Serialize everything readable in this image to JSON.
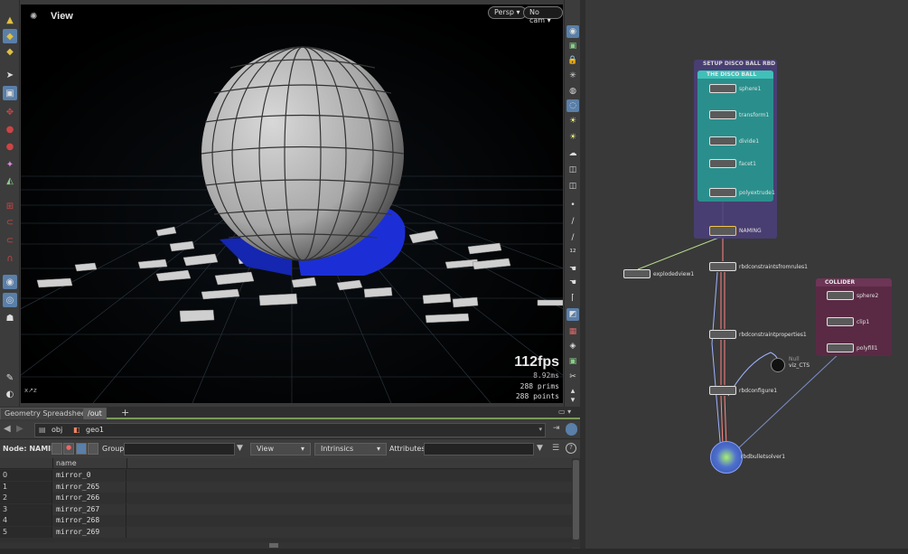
{
  "viewport": {
    "title": "View",
    "persp_label": "Persp ▾",
    "cam_label": "No cam ▾",
    "fps": "112fps",
    "ms": "8.92ms",
    "prims": "288  prims",
    "points": "288 points"
  },
  "tabs": [
    {
      "label": "Geometry Spreadsheet",
      "active": false
    },
    {
      "label": "/out",
      "active": true
    }
  ],
  "path": {
    "obj": "obj",
    "geo": "geo1"
  },
  "nodebar": {
    "node_label": "Node: NAMING",
    "group_label": "Group:",
    "view_label": "View",
    "intrinsics_label": "Intrinsics",
    "attributes_label": "Attributes:"
  },
  "sheet": {
    "column_name": "name",
    "rows": [
      {
        "idx": "0",
        "name": "mirror_0"
      },
      {
        "idx": "1",
        "name": "mirror_265"
      },
      {
        "idx": "2",
        "name": "mirror_266"
      },
      {
        "idx": "3",
        "name": "mirror_267"
      },
      {
        "idx": "4",
        "name": "mirror_268"
      },
      {
        "idx": "5",
        "name": "mirror_269"
      }
    ]
  },
  "network": {
    "setup_box": "SETUP DISCO BALL RBD",
    "discoball_box": "THE DISCO BALL",
    "collider_box": "COLLIDER",
    "nodes": {
      "sphere1": "sphere1",
      "transform1": "transform1",
      "divide1": "divide1",
      "facet1": "facet1",
      "polyextrude1": "polyextrude1",
      "naming": "NAMING",
      "explodedview1": "explodedview1",
      "rbdconstraintsfromrules1": "rbdconstraintsfromrules1",
      "rbdconstraintproperties1": "rbdconstraintproperties1",
      "rbdconfigure1": "rbdconfigure1",
      "viz_cts": "viz_CTS",
      "null_label": "Null",
      "rbdbulletsolver1": "rbdbulletsolver1",
      "sphere2": "sphere2",
      "clip1": "clip1",
      "polyfill1": "polyfill1"
    }
  },
  "colors": {
    "setup_box": "#4a3f78",
    "discoball_box": "#2a8f8c",
    "collider_box": "#5a2a45",
    "accent": "#5a7fa8",
    "floor_debris": "#1c2fd6"
  }
}
